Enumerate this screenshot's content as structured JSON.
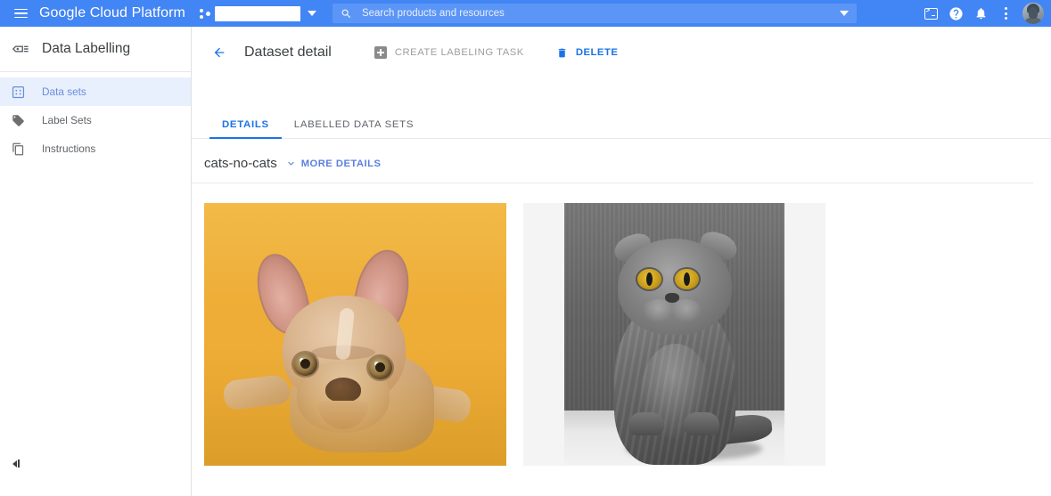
{
  "topbar": {
    "menu_icon": "hamburger-menu-icon",
    "brand": "Google Cloud Platform",
    "project_selector": {
      "icon": "project-dots-icon",
      "value": "",
      "caret_icon": "chevron-down-icon"
    },
    "search": {
      "icon": "search-icon",
      "placeholder": "Search products and resources",
      "value": "",
      "caret_icon": "chevron-down-icon"
    },
    "actions": [
      {
        "name": "cloud-shell-icon",
        "label": "Activate Cloud Shell"
      },
      {
        "name": "help-icon",
        "label": "Help",
        "glyph": "?"
      },
      {
        "name": "notifications-bell-icon",
        "label": "Notifications"
      },
      {
        "name": "more-options-icon",
        "label": "More options"
      }
    ],
    "avatar_label": "Account",
    "colors": {
      "nav_blue": "#4285f4",
      "search_blue": "#5b96f7"
    }
  },
  "sidebar": {
    "header": {
      "icon": "data-labelling-icon",
      "title": "Data Labelling"
    },
    "items": [
      {
        "label": "Data sets",
        "icon": "dataset-grid-icon",
        "active": true
      },
      {
        "label": "Label Sets",
        "icon": "label-tag-icon",
        "active": false
      },
      {
        "label": "Instructions",
        "icon": "instructions-icon",
        "active": false
      }
    ],
    "collapse_label": "Collapse navigation",
    "active_color": "#6b8cd8",
    "active_bg": "#e8f0fe"
  },
  "page": {
    "back_label": "Back",
    "title": "Dataset detail",
    "actions": [
      {
        "label": "CREATE LABELING TASK",
        "icon": "add-box-icon",
        "state": "disabled"
      },
      {
        "label": "DELETE",
        "icon": "trash-icon",
        "state": "enabled"
      }
    ],
    "tabs": [
      {
        "label": "DETAILS",
        "active": true
      },
      {
        "label": "LABELLED DATA SETS",
        "active": false
      }
    ],
    "dataset": {
      "name": "cats-no-cats",
      "more_details_label": "MORE DETAILS",
      "more_details_icon": "chevron-down-icon"
    },
    "thumbnails": [
      {
        "name": "dataset-image-dog",
        "alt": "French bulldog puppy lying on yellow background"
      },
      {
        "name": "dataset-image-cat",
        "alt": "Grey Scottish Fold cat sitting, black and white photo"
      }
    ],
    "accent_color": "#1a73e8"
  }
}
